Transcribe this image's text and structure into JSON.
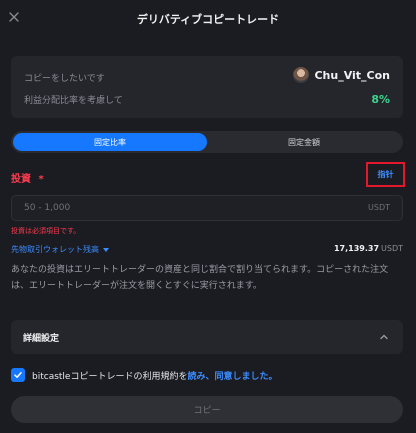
{
  "header": {
    "title": "デリバティブコピートレード"
  },
  "info": {
    "copy_label": "コピーをしたいです",
    "profit_label": "利益分配比率を考慮して",
    "trader_name": "Chu_Vit_Con",
    "profit_ratio": "8%"
  },
  "mode_tabs": [
    {
      "label": "固定比率",
      "active": true
    },
    {
      "label": "固定金額",
      "active": false
    }
  ],
  "invest": {
    "label": "投資",
    "required_mark": "*",
    "leverage_label": "指针",
    "placeholder": "50 - 1,000",
    "unit": "USDT",
    "error": "投資は必須項目です。"
  },
  "wallet": {
    "label": "先物取引ウォレット残高",
    "balance": "17,139.37",
    "currency": "USDT"
  },
  "description": "あなたの投資はエリートトレーダーの資産と同じ割合で割り当てられます。コピーされた注文は、エリートトレーダーが注文を開くとすぐに実行されます。",
  "details": {
    "label": "詳細設定"
  },
  "agreement": {
    "checked": true,
    "text": "bitcastleコピートレードの利用規約を",
    "link": "読み、同意しました。"
  },
  "submit": {
    "label": "コピー"
  },
  "colors": {
    "accent": "#1677ff",
    "link": "#3b8cff",
    "error": "#ff3b4f",
    "positive": "#3fd18b",
    "background": "#1b1c21"
  }
}
